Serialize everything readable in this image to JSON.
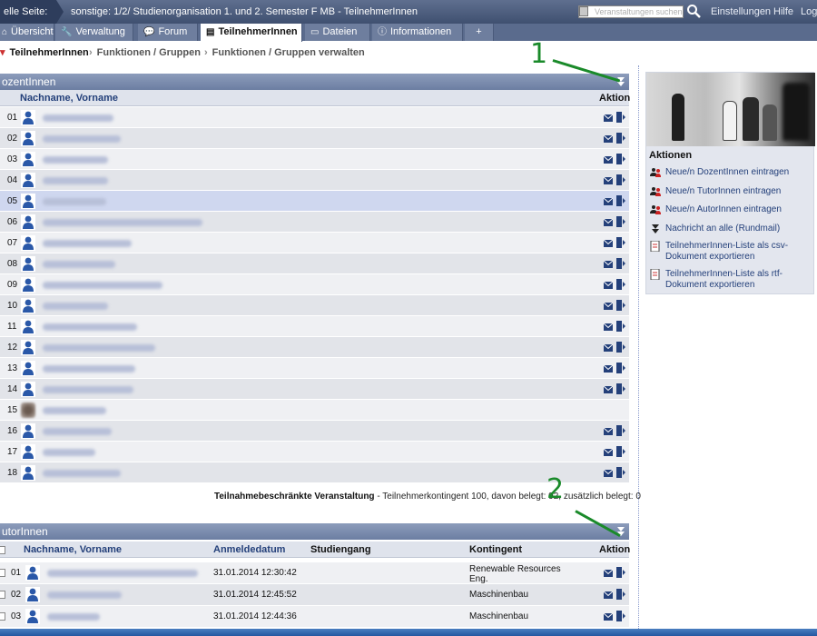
{
  "topbar": {
    "crumb_left": "elle Seite:",
    "course_title": "sonstige: 1/2/ Studienorganisation 1. und 2. Semester F MB - TeilnehmerInnen",
    "search_placeholder": "Veranstaltungen suchen",
    "links": [
      "Einstellungen",
      "Hilfe",
      "Log"
    ]
  },
  "tabs": [
    {
      "label": "Übersicht",
      "icon": "home-icon"
    },
    {
      "label": "Verwaltung",
      "icon": "wrench-icon"
    },
    {
      "label": "Forum",
      "icon": "speech-bubble-icon"
    },
    {
      "label": "TeilnehmerInnen",
      "icon": "people-icon",
      "active": true
    },
    {
      "label": "Dateien",
      "icon": "file-icon"
    },
    {
      "label": "Informationen",
      "icon": "info-icon"
    },
    {
      "label": "+",
      "icon": ""
    }
  ],
  "subnav": [
    "TeilnehmerInnen",
    "Funktionen / Gruppen",
    "Funktionen / Gruppen verwalten"
  ],
  "dozenten": {
    "title": "ozentInnen",
    "col_name": "Nachname, Vorname",
    "col_action": "Aktion",
    "rows": [
      {
        "num": "01"
      },
      {
        "num": "02"
      },
      {
        "num": "03"
      },
      {
        "num": "04"
      },
      {
        "num": "05",
        "highlight": true
      },
      {
        "num": "06"
      },
      {
        "num": "07"
      },
      {
        "num": "08"
      },
      {
        "num": "09"
      },
      {
        "num": "10"
      },
      {
        "num": "11"
      },
      {
        "num": "12"
      },
      {
        "num": "13"
      },
      {
        "num": "14"
      },
      {
        "num": "15",
        "photo": true,
        "no_actions": true
      },
      {
        "num": "16"
      },
      {
        "num": "17"
      },
      {
        "num": "18"
      }
    ]
  },
  "limit": {
    "bold": "Teilnahmebeschränkte Veranstaltung",
    "rest": " - Teilnehmerkontingent 100, davon belegt: 92, zusätzlich belegt: 0"
  },
  "autoren": {
    "title": "utorInnen",
    "col_name": "Nachname, Vorname",
    "col_date": "Anmeldedatum",
    "col_study": "Studiengang",
    "col_quota": "Kontingent",
    "col_action": "Aktion",
    "rows": [
      {
        "num": "01",
        "date": "31.01.2014 12:30:42",
        "quota_1": "Renewable Resources",
        "quota_2": "Eng."
      },
      {
        "num": "02",
        "date": "31.01.2014 12:45:52",
        "quota_1": "Maschinenbau",
        "quota_2": ""
      },
      {
        "num": "03",
        "date": "31.01.2014 12:44:36",
        "quota_1": "Maschinenbau",
        "quota_2": ""
      }
    ]
  },
  "sidebar": {
    "heading": "Aktionen",
    "actions": [
      {
        "label": "Neue/n DozentInnen eintragen",
        "icon": "add-people-icon"
      },
      {
        "label": "Neue/n TutorInnen eintragen",
        "icon": "add-people-icon"
      },
      {
        "label": "Neue/n AutorInnen eintragen",
        "icon": "add-people-icon"
      },
      {
        "label": "Nachricht an alle (Rundmail)",
        "icon": "mail-all-icon"
      },
      {
        "label": "TeilnehmerInnen-Liste als csv-Dokument exportieren",
        "icon": "export-csv-icon"
      },
      {
        "label": "TeilnehmerInnen-Liste als rtf-Dokument exportieren",
        "icon": "export-rtf-icon"
      }
    ]
  },
  "annotations": [
    "1",
    "2"
  ],
  "colors": {
    "accent": "#24407a",
    "header": "#7a8bae",
    "annotation": "#1a8a2a"
  }
}
